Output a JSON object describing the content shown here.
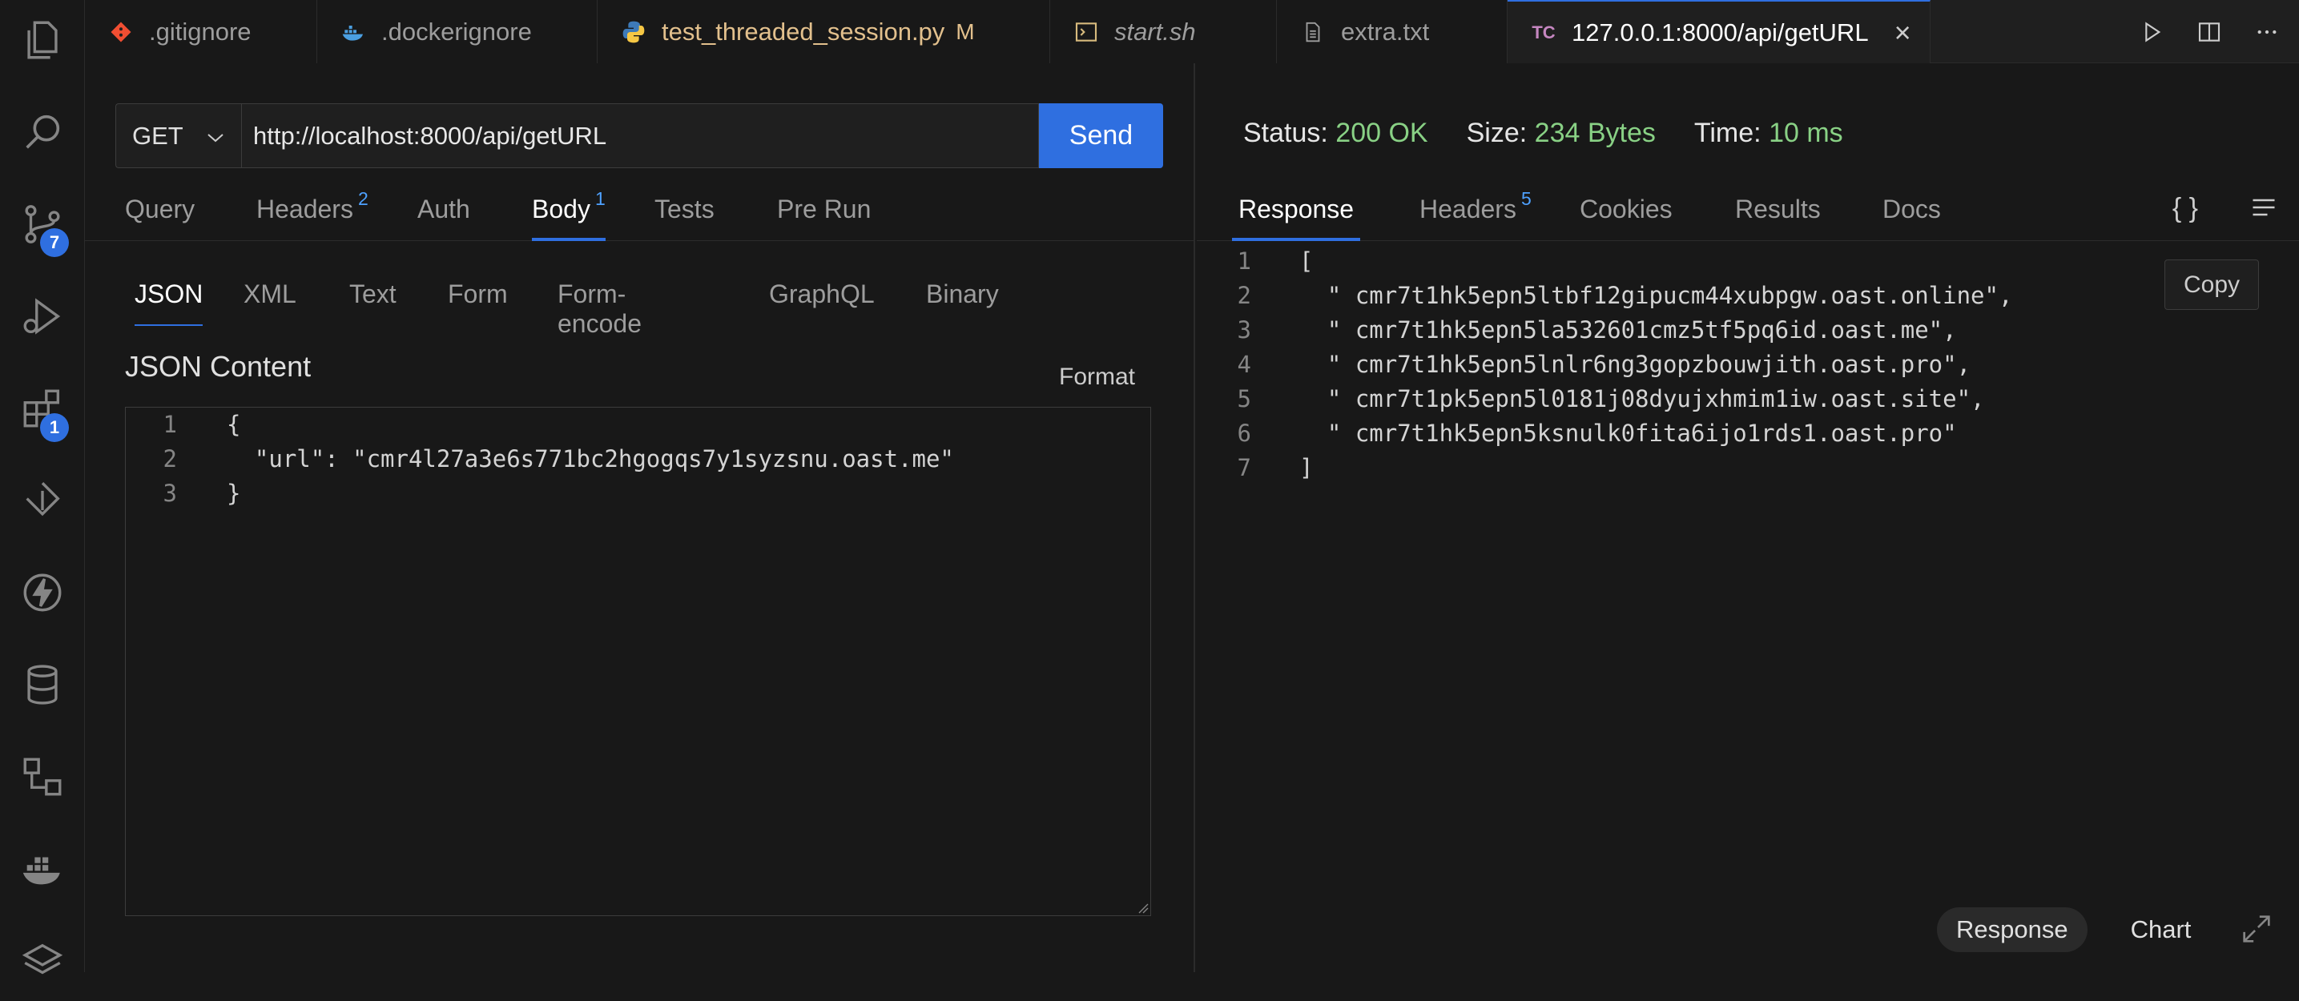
{
  "activity_bar": {
    "source_control_badge": "7",
    "extensions_badge": "1"
  },
  "tabs": [
    {
      "label": ".gitignore",
      "icon": "git-icon",
      "color": "#f14e32"
    },
    {
      "label": ".dockerignore",
      "icon": "docker-icon",
      "color": "#4b9fe1"
    },
    {
      "label": "test_threaded_session.py",
      "modified_marker": "M",
      "icon": "python-icon"
    },
    {
      "label": "start.sh",
      "icon": "terminal-icon"
    },
    {
      "label": "extra.txt",
      "icon": "file-text-icon"
    },
    {
      "label": "127.0.0.1:8000/api/getURL",
      "icon_text": "TC",
      "active": true
    }
  ],
  "request": {
    "method": "GET",
    "url": "http://localhost:8000/api/getURL",
    "send_label": "Send",
    "tabs": [
      {
        "label": "Query"
      },
      {
        "label": "Headers",
        "count": "2"
      },
      {
        "label": "Auth"
      },
      {
        "label": "Body",
        "count": "1",
        "active": true
      },
      {
        "label": "Tests"
      },
      {
        "label": "Pre Run"
      }
    ],
    "body_tabs": [
      "JSON",
      "XML",
      "Text",
      "Form",
      "Form-encode",
      "GraphQL",
      "Binary"
    ],
    "json_content_label": "JSON Content",
    "format_label": "Format",
    "body_lines": [
      {
        "n": "1",
        "text": "{"
      },
      {
        "n": "2",
        "text": "  \"url\": \"cmr4l27a3e6s771bc2hgogqs7y1syzsnu.oast.me\""
      },
      {
        "n": "3",
        "text": "}"
      }
    ]
  },
  "response": {
    "status_label": "Status:",
    "status_value": "200 OK",
    "size_label": "Size:",
    "size_value": "234 Bytes",
    "time_label": "Time:",
    "time_value": "10 ms",
    "tabs": [
      {
        "label": "Response",
        "active": true
      },
      {
        "label": "Headers",
        "count": "5"
      },
      {
        "label": "Cookies"
      },
      {
        "label": "Results"
      },
      {
        "label": "Docs"
      }
    ],
    "braces_icon": "{ }",
    "copy_label": "Copy",
    "lines": [
      {
        "n": "1",
        "text": "["
      },
      {
        "n": "2",
        "text": "  \" cmr7t1hk5epn5ltbf12gipucm44xubpgw.oast.online\","
      },
      {
        "n": "3",
        "text": "  \" cmr7t1hk5epn5la532601cmz5tf5pq6id.oast.me\","
      },
      {
        "n": "4",
        "text": "  \" cmr7t1hk5epn5lnlr6ng3gopzbouwjith.oast.pro\","
      },
      {
        "n": "5",
        "text": "  \" cmr7t1pk5epn5l0181j08dyujxhmim1iw.oast.site\","
      },
      {
        "n": "6",
        "text": "  \" cmr7t1hk5epn5ksnulk0fita6ijo1rds1.oast.pro\""
      },
      {
        "n": "7",
        "text": "]"
      }
    ],
    "view_response_label": "Response",
    "view_chart_label": "Chart"
  },
  "colors": {
    "accent": "#2f6fe0",
    "success": "#89d185",
    "modified": "#e2c08d",
    "badge_tab": "#4ea1ff"
  }
}
